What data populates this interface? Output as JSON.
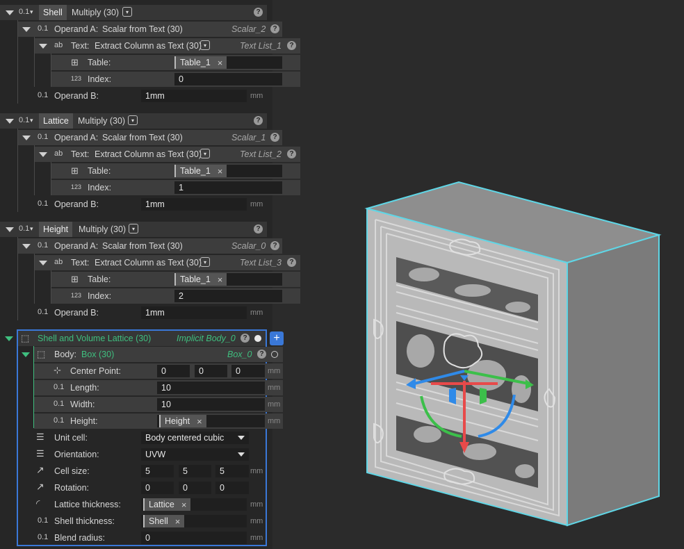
{
  "blocks": [
    {
      "head_tag": "Shell",
      "head_op": "Multiply (30)",
      "operand_a_label": "Operand A:",
      "operand_a_value": "Scalar from Text (30)",
      "operand_a_name": "Scalar_2",
      "text_label": "Text:",
      "text_value": "Extract Column as Text (30)",
      "text_name": "Text List_1",
      "table_label": "Table:",
      "table_chip": "Table_1",
      "index_label": "Index:",
      "index_value": "0",
      "operand_b_label": "Operand B:",
      "operand_b_value": "1mm",
      "unit": "mm"
    },
    {
      "head_tag": "Lattice",
      "head_op": "Multiply (30)",
      "operand_a_label": "Operand A:",
      "operand_a_value": "Scalar from Text (30)",
      "operand_a_name": "Scalar_1",
      "text_label": "Text:",
      "text_value": "Extract Column as Text (30)",
      "text_name": "Text List_2",
      "table_label": "Table:",
      "table_chip": "Table_1",
      "index_label": "Index:",
      "index_value": "1",
      "operand_b_label": "Operand B:",
      "operand_b_value": "1mm",
      "unit": "mm"
    },
    {
      "head_tag": "Height",
      "head_op": "Multiply (30)",
      "operand_a_label": "Operand A:",
      "operand_a_value": "Scalar from Text (30)",
      "operand_a_name": "Scalar_0",
      "text_label": "Text:",
      "text_value": "Extract Column as Text (30)",
      "text_name": "Text List_3",
      "table_label": "Table:",
      "table_chip": "Table_1",
      "index_label": "Index:",
      "index_value": "2",
      "operand_b_label": "Operand B:",
      "operand_b_value": "1mm",
      "unit": "mm"
    }
  ],
  "lattice_node": {
    "title": "Shell and Volume Lattice (30)",
    "name": "Implicit Body_0",
    "add_label": "+",
    "body_label": "Body:",
    "body_value": "Box (30)",
    "body_name": "Box_0",
    "center_label": "Center Point:",
    "center": [
      "0",
      "0",
      "0"
    ],
    "length_label": "Length:",
    "length": "10",
    "width_label": "Width:",
    "width": "10",
    "height_label": "Height:",
    "height_chip": "Height",
    "unit_cell_label": "Unit cell:",
    "unit_cell": "Body centered cubic",
    "orientation_label": "Orientation:",
    "orientation": "UVW",
    "cell_size_label": "Cell size:",
    "cell_size": [
      "5",
      "5",
      "5"
    ],
    "rotation_label": "Rotation:",
    "rotation": [
      "0",
      "0",
      "0"
    ],
    "lattice_thickness_label": "Lattice thickness:",
    "lattice_thickness_chip": "Lattice",
    "shell_thickness_label": "Shell thickness:",
    "shell_thickness_chip": "Shell",
    "blend_radius_label": "Blend radius:",
    "blend_radius": "0",
    "unit": "mm"
  },
  "icons": {
    "scalar": "0.1",
    "integer": "123",
    "text": "ab",
    "help": "?",
    "close": "×"
  },
  "colors": {
    "accent_blue": "#3a78d8",
    "accent_green": "#3fbf7f",
    "viewport_bg": "#2b2b2b",
    "selection_outline": "#5fd6e6",
    "gizmo_red": "#e84a4a",
    "gizmo_green": "#3cbf4a",
    "gizmo_blue": "#2f8ae8"
  }
}
